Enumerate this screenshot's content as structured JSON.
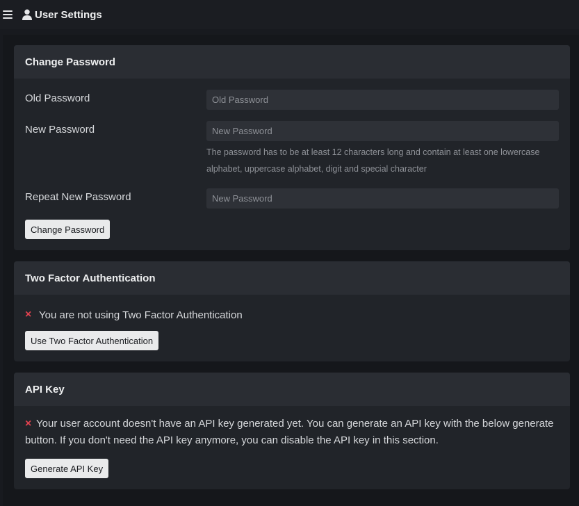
{
  "header": {
    "title": "User Settings"
  },
  "change_password": {
    "heading": "Change Password",
    "old_label": "Old Password",
    "old_placeholder": "Old Password",
    "new_label": "New Password",
    "new_placeholder": "New Password",
    "hint": "The password has to be at least 12 characters long and contain at least one lowercase alphabet, uppercase alphabet, digit and special character",
    "repeat_label": "Repeat New Password",
    "repeat_placeholder": "New Password",
    "button": "Change Password"
  },
  "two_factor": {
    "heading": "Two Factor Authentication",
    "status_icon": "×",
    "status": "You are not using Two Factor Authentication",
    "button": "Use Two Factor Authentication"
  },
  "api_key": {
    "heading": "API Key",
    "status_icon": "×",
    "message": "Your user account doesn't have an API key generated yet. You can generate an API key with the below generate button. If you don't need the API key anymore, you can disable the API key in this section.",
    "button": "Generate API Key"
  },
  "colors": {
    "error": "#e0424f"
  }
}
